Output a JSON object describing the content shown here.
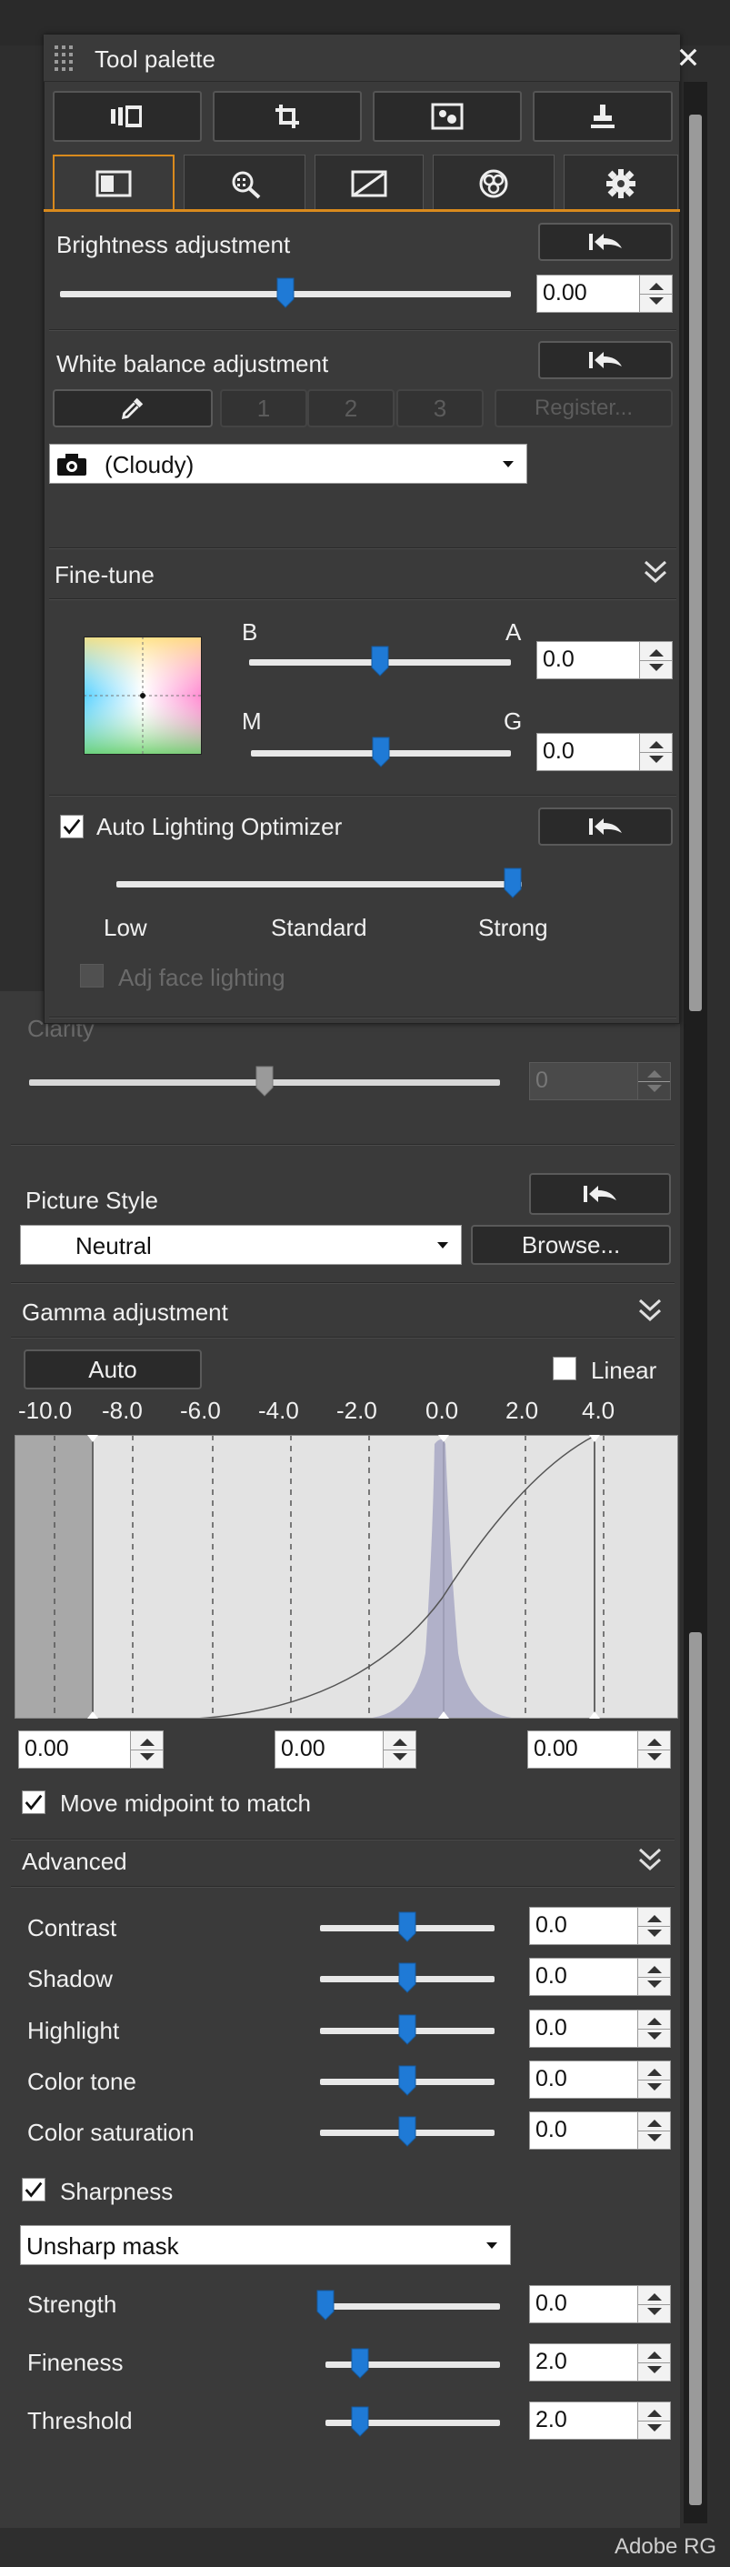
{
  "palette": {
    "title": "Tool palette",
    "tools": [
      {
        "icon": "filmstrip-icon"
      },
      {
        "icon": "crop-icon"
      },
      {
        "icon": "dust-removal-icon"
      },
      {
        "icon": "stamp-icon"
      }
    ],
    "tabs": [
      {
        "icon": "basic-adjust-icon",
        "active": true
      },
      {
        "icon": "detail-zoom-icon",
        "active": false
      },
      {
        "icon": "tone-curve-icon",
        "active": false
      },
      {
        "icon": "color-adjust-icon",
        "active": false
      },
      {
        "icon": "settings-gear-icon",
        "active": false
      }
    ],
    "brightness": {
      "label": "Brightness adjustment",
      "value": "0.00",
      "level": 0.5
    },
    "white_balance": {
      "label": "White balance adjustment",
      "presets": [
        "1",
        "2",
        "3"
      ],
      "register": "Register...",
      "selected": "(Cloudy)"
    },
    "fine_tune": {
      "label": "Fine-tune",
      "b_label": "B",
      "a_label": "A",
      "m_label": "M",
      "g_label": "G",
      "ba_value": "0.0",
      "mg_value": "0.0",
      "ba_level": 0.5,
      "mg_level": 0.5
    },
    "alo": {
      "label": "Auto Lighting Optimizer",
      "checked": true,
      "low": "Low",
      "standard": "Standard",
      "strong": "Strong",
      "level": 1.0,
      "face": "Adj face lighting"
    }
  },
  "panel": {
    "clarity": {
      "label": "Clarity",
      "value": "0",
      "level": 0.5
    },
    "picture_style": {
      "label": "Picture Style",
      "selected": "Neutral",
      "browse": "Browse..."
    },
    "gamma": {
      "label": "Gamma adjustment",
      "auto": "Auto",
      "linear": "Linear",
      "ticks": [
        "-10.0",
        "-8.0",
        "-6.0",
        "-4.0",
        "-2.0",
        "0.0",
        "2.0",
        "4.0"
      ],
      "black": "0.00",
      "mid": "0.00",
      "white": "0.00",
      "move_midpoint": "Move midpoint to match"
    },
    "advanced": {
      "label": "Advanced",
      "rows": [
        {
          "label": "Contrast",
          "value": "0.0",
          "level": 0.5
        },
        {
          "label": "Shadow",
          "value": "0.0",
          "level": 0.5
        },
        {
          "label": "Highlight",
          "value": "0.0",
          "level": 0.5
        },
        {
          "label": "Color tone",
          "value": "0.0",
          "level": 0.5
        },
        {
          "label": "Color saturation",
          "value": "0.0",
          "level": 0.5
        }
      ]
    },
    "sharpness": {
      "label": "Sharpness",
      "mode": "Unsharp mask",
      "rows": [
        {
          "label": "Strength",
          "value": "0.0",
          "level": 0.0
        },
        {
          "label": "Fineness",
          "value": "2.0",
          "level": 0.2
        },
        {
          "label": "Threshold",
          "value": "2.0",
          "level": 0.2
        }
      ]
    }
  },
  "footer": {
    "text": "Adobe RG"
  },
  "colors": {
    "accent": "#d98a1d",
    "thumb": "#1f7ad6",
    "panel": "#3a3a3a"
  }
}
